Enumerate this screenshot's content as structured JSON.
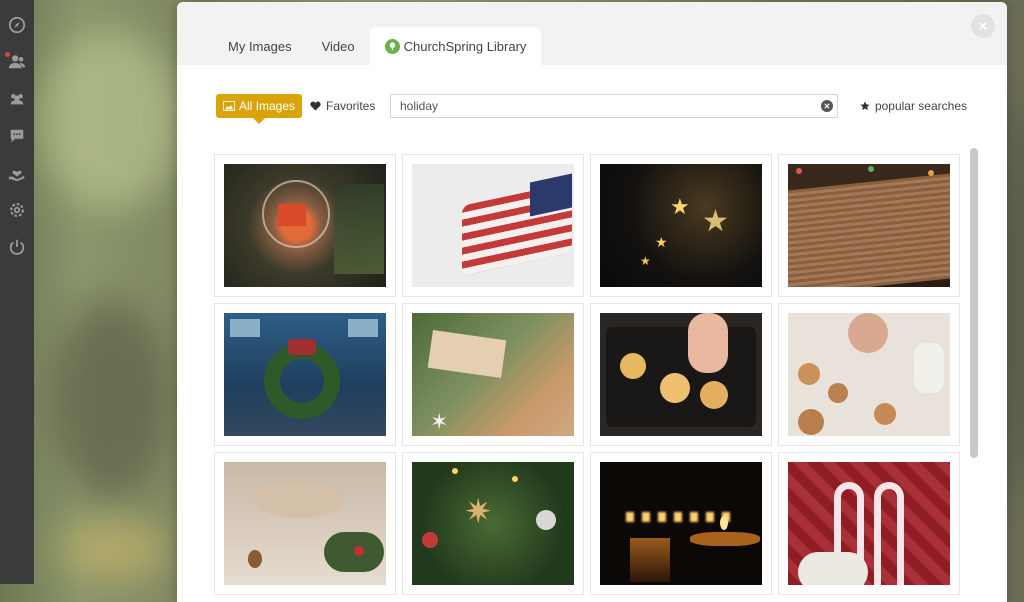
{
  "tabs": [
    {
      "label": "My Images"
    },
    {
      "label": "Video"
    },
    {
      "label": "ChurchSpring Library"
    }
  ],
  "filters": {
    "all_images": "All Images",
    "favorites": "Favorites",
    "search_value": "holiday",
    "popular_searches": "popular searches"
  },
  "rail_icons": [
    "compass-icon",
    "people-icon",
    "groups-icon",
    "chat-icon",
    "giving-hand-icon",
    "settings-icon",
    "power-icon"
  ],
  "images": [
    {
      "name": "ornament-house"
    },
    {
      "name": "american-flag"
    },
    {
      "name": "star-lights"
    },
    {
      "name": "open-book"
    },
    {
      "name": "truck-wreath"
    },
    {
      "name": "merry-christmas-tag"
    },
    {
      "name": "gingerbread-tray"
    },
    {
      "name": "cookie-decorating"
    },
    {
      "name": "holiday-table"
    },
    {
      "name": "tree-ornaments"
    },
    {
      "name": "candles"
    },
    {
      "name": "candy-canes"
    }
  ],
  "colors": {
    "accent": "#d9a30a",
    "library_leaf": "#6ab04c",
    "rail": "#3a3b3d",
    "notification": "#e0433b"
  }
}
